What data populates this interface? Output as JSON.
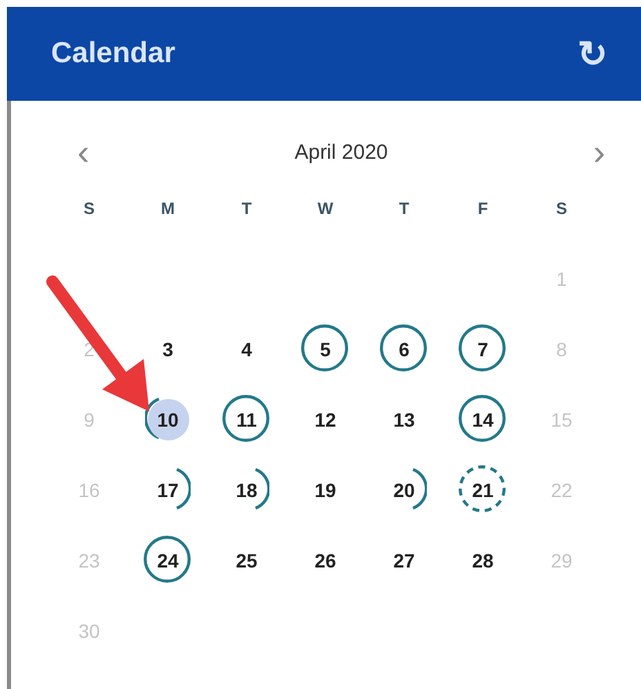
{
  "header": {
    "title": "Calendar",
    "refresh_icon": "↻"
  },
  "nav": {
    "prev": "‹",
    "month": "April 2020",
    "next": "›"
  },
  "weekdays": [
    "S",
    "M",
    "T",
    "W",
    "T",
    "F",
    "S"
  ],
  "weeks": [
    [
      {
        "kind": "blank"
      },
      {
        "kind": "blank"
      },
      {
        "kind": "blank"
      },
      {
        "kind": "blank"
      },
      {
        "kind": "blank"
      },
      {
        "kind": "blank"
      },
      {
        "kind": "plain",
        "label": "1",
        "muted": true,
        "selected": false
      }
    ],
    [
      {
        "kind": "plain",
        "label": "2",
        "muted": true,
        "selected": false
      },
      {
        "kind": "plain",
        "label": "3",
        "muted": false,
        "selected": false
      },
      {
        "kind": "plain",
        "label": "4",
        "muted": false,
        "selected": false
      },
      {
        "kind": "ring",
        "label": "5",
        "muted": false,
        "selected": false
      },
      {
        "kind": "ring",
        "label": "6",
        "muted": false,
        "selected": false
      },
      {
        "kind": "ring",
        "label": "7",
        "muted": false,
        "selected": false
      },
      {
        "kind": "plain",
        "label": "8",
        "muted": true,
        "selected": false
      }
    ],
    [
      {
        "kind": "plain",
        "label": "9",
        "muted": true,
        "selected": false
      },
      {
        "kind": "leftarc",
        "label": "10",
        "muted": false,
        "selected": true
      },
      {
        "kind": "ring",
        "label": "11",
        "muted": false,
        "selected": false
      },
      {
        "kind": "plain",
        "label": "12",
        "muted": false,
        "selected": false
      },
      {
        "kind": "plain",
        "label": "13",
        "muted": false,
        "selected": false
      },
      {
        "kind": "ring",
        "label": "14",
        "muted": false,
        "selected": false
      },
      {
        "kind": "plain",
        "label": "15",
        "muted": true,
        "selected": false
      }
    ],
    [
      {
        "kind": "plain",
        "label": "16",
        "muted": true,
        "selected": false
      },
      {
        "kind": "rightarc",
        "label": "17",
        "muted": false,
        "selected": false
      },
      {
        "kind": "rightarc",
        "label": "18",
        "muted": false,
        "selected": false
      },
      {
        "kind": "plain",
        "label": "19",
        "muted": false,
        "selected": false
      },
      {
        "kind": "rightarc",
        "label": "20",
        "muted": false,
        "selected": false
      },
      {
        "kind": "dashed",
        "label": "21",
        "muted": false,
        "selected": false
      },
      {
        "kind": "plain",
        "label": "22",
        "muted": true,
        "selected": false
      }
    ],
    [
      {
        "kind": "plain",
        "label": "23",
        "muted": true,
        "selected": false
      },
      {
        "kind": "ring",
        "label": "24",
        "muted": false,
        "selected": false
      },
      {
        "kind": "plain",
        "label": "25",
        "muted": false,
        "selected": false
      },
      {
        "kind": "plain",
        "label": "26",
        "muted": false,
        "selected": false
      },
      {
        "kind": "plain",
        "label": "27",
        "muted": false,
        "selected": false
      },
      {
        "kind": "plain",
        "label": "28",
        "muted": false,
        "selected": false
      },
      {
        "kind": "plain",
        "label": "29",
        "muted": true,
        "selected": false
      }
    ],
    [
      {
        "kind": "plain",
        "label": "30",
        "muted": true,
        "selected": false
      },
      {
        "kind": "blank"
      },
      {
        "kind": "blank"
      },
      {
        "kind": "blank"
      },
      {
        "kind": "blank"
      },
      {
        "kind": "blank"
      },
      {
        "kind": "blank"
      }
    ]
  ]
}
